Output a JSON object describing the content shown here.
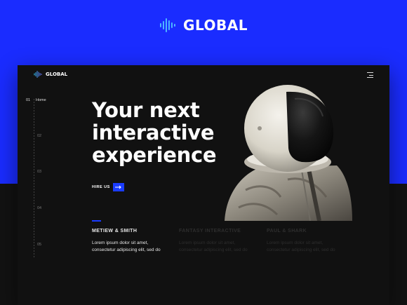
{
  "brand": {
    "name": "GLOBAL",
    "icon": "soundwave-logo-icon"
  },
  "card": {
    "logo_name": "GLOBAL",
    "menu_icon": "hamburger-menu-icon",
    "sidebar": [
      {
        "num": "01",
        "label": "Home",
        "active": true
      },
      {
        "num": "02",
        "label": ""
      },
      {
        "num": "03",
        "label": ""
      },
      {
        "num": "04",
        "label": ""
      },
      {
        "num": "05",
        "label": ""
      }
    ],
    "hero": {
      "line1": "Your next",
      "line2": "interactive",
      "line3": "experience",
      "cta_label": "HIRE US"
    },
    "projects": [
      {
        "title": "METIEW & SMITH",
        "text1": "Lorem ipsum dolor sit amet,",
        "text2": "consectetur adipiscing elit, sed do"
      },
      {
        "title": "FANTASY INTERACTIVE",
        "text1": "Lorem ipsum dolor sit amet,",
        "text2": "consectetur adipiscing elit, sed do"
      },
      {
        "title": "PAUL & SHARK",
        "text1": "Lorem ipsum dolor sit amet,",
        "text2": "consectetur adipiscing elit, sed do"
      }
    ]
  },
  "colors": {
    "blue_bg": "#1a2cff",
    "accent": "#1a3cff",
    "dark": "#111111"
  }
}
